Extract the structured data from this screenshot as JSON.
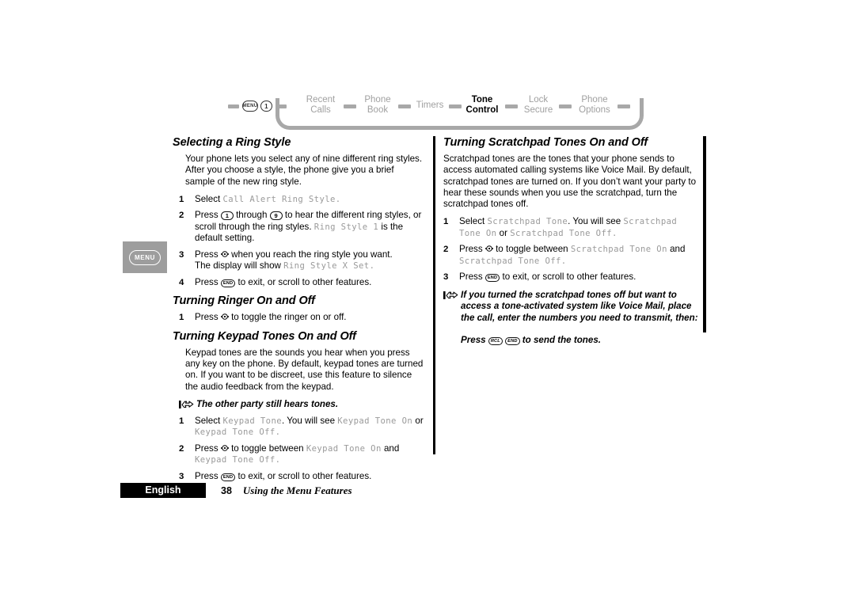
{
  "menu_map": {
    "keys": [
      {
        "name": "menu-key",
        "label": "MENU"
      },
      {
        "name": "digit-1-key",
        "label": "1"
      }
    ],
    "items": [
      {
        "label_line1": "Recent",
        "label_line2": "Calls",
        "active": false
      },
      {
        "label_line1": "Phone",
        "label_line2": "Book",
        "active": false
      },
      {
        "label_line1": "Timers",
        "label_line2": "",
        "active": false
      },
      {
        "label_line1": "Tone",
        "label_line2": "Control",
        "active": true
      },
      {
        "label_line1": "Lock",
        "label_line2": "Secure",
        "active": false
      },
      {
        "label_line1": "Phone",
        "label_line2": "Options",
        "active": false
      }
    ],
    "colors": {
      "inactive": "#a0a0a0",
      "active": "#000000",
      "track": "#a8a8a8"
    }
  },
  "sidebar_icon": {
    "label": "MENU"
  },
  "left_column": {
    "section1": {
      "heading": "Selecting a Ring Style",
      "body": "Your phone lets you select any of nine different ring styles. After you choose a style, the phone give you a brief sample of the new ring style.",
      "steps": [
        {
          "num": "1",
          "pre": "Select ",
          "lcd1": "Call Alert Ring Style",
          "post": "."
        },
        {
          "num": "2",
          "pre": "Press ",
          "key1": "1",
          "mid1": " through ",
          "key2": "9",
          "mid2": " to hear the different ring styles, or scroll through the ring styles. ",
          "lcd1": "Ring Style 1",
          "post": " is the default setting."
        },
        {
          "num": "3",
          "pre": "Press ",
          "key_select": "select-key",
          "post": " when you reach the ring style you want.",
          "subline_pre": "The display will show ",
          "subline_lcd": "Ring Style X Set",
          "subline_post": "."
        },
        {
          "num": "4",
          "pre": "Press ",
          "key1_label": "END",
          "post": " to exit, or scroll to other features."
        }
      ]
    },
    "section2": {
      "heading": "Turning Ringer On and Off",
      "steps": [
        {
          "num": "1",
          "pre": "Press ",
          "key_select": "select-key",
          "post": " to toggle the ringer on or off."
        }
      ]
    },
    "section3": {
      "heading": "Turning Keypad Tones On and Off",
      "body": "Keypad tones are the sounds you hear when you press any key on the phone. By default, keypad tones are turned on. If you want to be discreet, use this feature to silence the audio feedback from the keypad.",
      "tip": "The other party still hears tones.",
      "steps": [
        {
          "num": "1",
          "pre": "Select ",
          "lcd1": "Keypad Tone",
          "mid1": ". You will see ",
          "lcd2": "Keypad Tone On",
          "mid2": " or ",
          "lcd3": "Keypad Tone Off",
          "post": "."
        },
        {
          "num": "2",
          "pre": "Press ",
          "key_select": "select-key",
          "mid1": " to toggle between ",
          "lcd1": "Keypad Tone On",
          "mid2": " and ",
          "lcd2": "Keypad Tone Off",
          "post": "."
        },
        {
          "num": "3",
          "pre": "Press ",
          "key1_label": "END",
          "post": " to exit, or scroll to other features."
        }
      ]
    }
  },
  "right_column": {
    "section1": {
      "heading": "Turning Scratchpad Tones On and Off",
      "body": "Scratchpad tones are the tones that your phone sends to access automated calling systems like Voice Mail. By default, scratchpad tones are turned on. If you don’t want your party to hear these sounds when you use the scratchpad, turn the scratchpad tones off.",
      "steps": [
        {
          "num": "1",
          "pre": "Select ",
          "lcd1": "Scratchpad Tone",
          "mid1": ". You will see ",
          "lcd2": "Scratchpad Tone On",
          "mid2": " or ",
          "lcd3": "Scratchpad Tone Off",
          "post": "."
        },
        {
          "num": "2",
          "pre": "Press ",
          "key_select": "select-key",
          "mid1": " to toggle between ",
          "lcd1": "Scratchpad Tone On",
          "mid2": " and ",
          "lcd2": "Scratchpad Tone Off",
          "post": "."
        },
        {
          "num": "3",
          "pre": "Press ",
          "key1_label": "END",
          "post": " to exit, or scroll to other features."
        }
      ],
      "tip": "If you turned the scratchpad tones off but want to access a tone-activated system like Voice Mail, place the call, enter the numbers you need to transmit, then:",
      "tip_extra_pre": "Press ",
      "tip_extra_key1": "RCL",
      "tip_extra_key2": "END",
      "tip_extra_post": " to send the tones."
    }
  },
  "footer": {
    "language": "English",
    "page_number": "38",
    "title": "Using the Menu Features"
  }
}
